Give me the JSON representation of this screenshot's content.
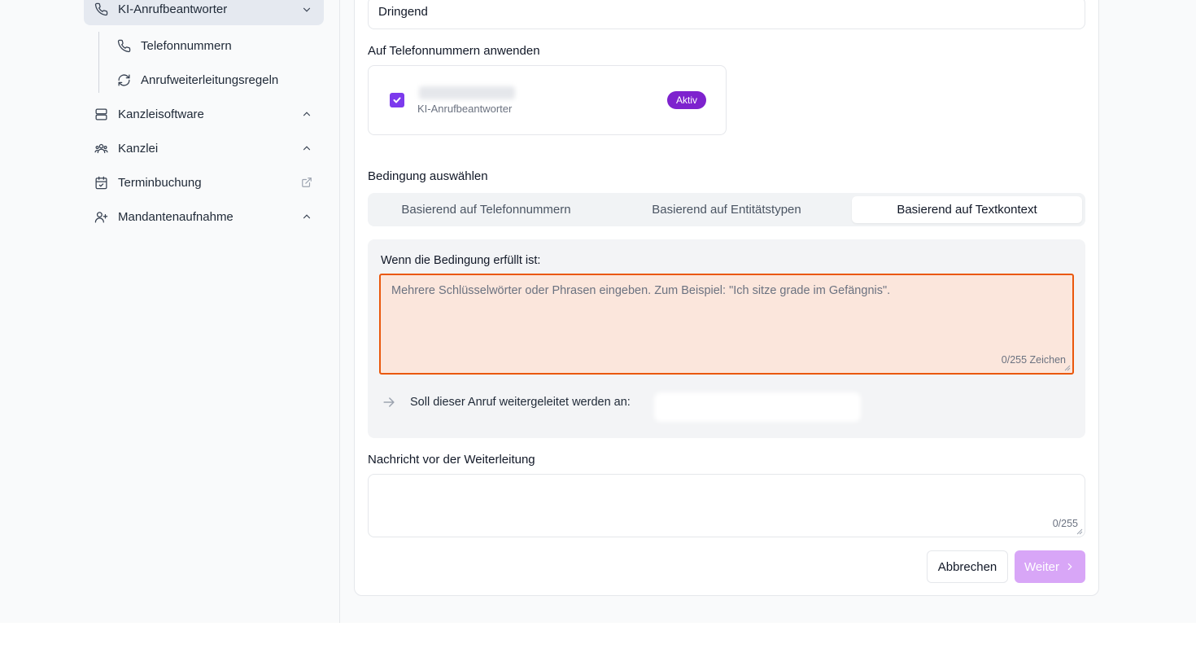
{
  "sidebar": {
    "items": [
      {
        "label": "KI-Anrufbeantworter",
        "icon": "phone-icon"
      },
      {
        "label": "Telefonnummern",
        "icon": "phone-icon"
      },
      {
        "label": "Anrufweiterleitungsregeln",
        "icon": "refresh-icon"
      },
      {
        "label": "Kanzleisoftware",
        "icon": "server-icon"
      },
      {
        "label": "Kanzlei",
        "icon": "users-icon"
      },
      {
        "label": "Terminbuchung",
        "icon": "calendar-check-icon"
      },
      {
        "label": "Mandantenaufnahme",
        "icon": "user-plus-icon"
      }
    ]
  },
  "form": {
    "priority_value": "Dringend",
    "apply_label": "Auf Telefonnummern anwenden",
    "phone_type": "KI-Anrufbeantworter",
    "phone_status": "Aktiv",
    "condition_label": "Bedingung auswählen",
    "tabs": [
      {
        "label": "Basierend auf Telefonnummern"
      },
      {
        "label": "Basierend auf Entitätstypen"
      },
      {
        "label": "Basierend auf Textkontext"
      }
    ],
    "condition_met_label": "Wenn die Bedingung erfüllt ist:",
    "keywords_placeholder": "Mehrere Schlüsselwörter oder Phrasen eingeben. Zum Beispiel: \"Ich sitze grade im Gefängnis\".",
    "keywords_counter": "0/255 Zeichen",
    "forward_label": "Soll dieser Anruf weitergeleitet werden an:",
    "message_label": "Nachricht vor der Weiterleitung",
    "message_counter": "0/255",
    "cancel_label": "Abbrechen",
    "next_label": "Weiter"
  },
  "colors": {
    "accent": "#7c3aed",
    "badge": "#7e22ce",
    "error_border": "#ea580c",
    "error_bg": "#fbe6dc",
    "next_disabled": "#d8a6f7"
  }
}
